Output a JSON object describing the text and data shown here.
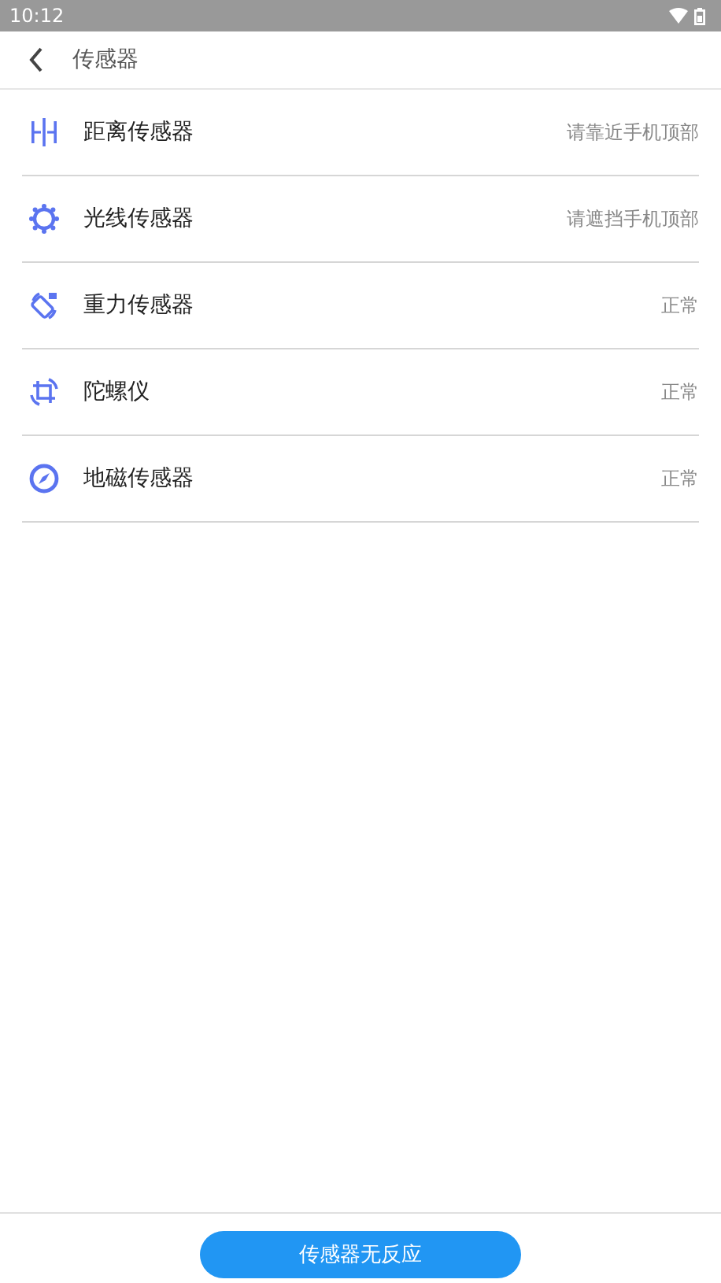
{
  "status_bar": {
    "time": "10:12"
  },
  "header": {
    "title": "传感器"
  },
  "sensors": [
    {
      "kind": "proximity",
      "name": "距离传感器",
      "status": "请靠近手机顶部"
    },
    {
      "kind": "light",
      "name": "光线传感器",
      "status": "请遮挡手机顶部"
    },
    {
      "kind": "gravity",
      "name": "重力传感器",
      "status": "正常"
    },
    {
      "kind": "gyroscope",
      "name": "陀螺仪",
      "status": "正常"
    },
    {
      "kind": "compass",
      "name": "地磁传感器",
      "status": "正常"
    }
  ],
  "footer_button": "传感器无反应"
}
